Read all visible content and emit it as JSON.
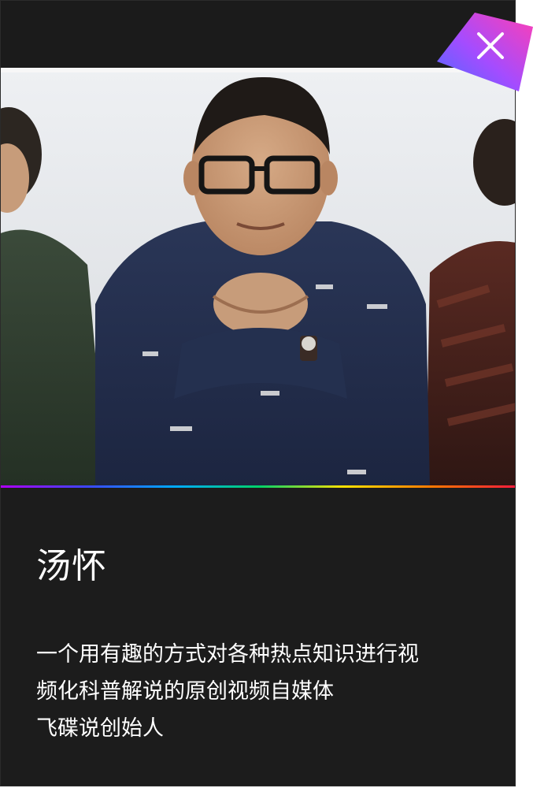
{
  "profile": {
    "name": "汤怀",
    "bio_lines": [
      "一个用有趣的方式对各种热点知识进行视",
      "频化科普解说的原创视频自媒体",
      "飞碟说创始人"
    ]
  },
  "photo": {
    "alt": "Portrait photo"
  },
  "icons": {
    "close": "close-icon"
  },
  "colors": {
    "background": "#1c1c1c",
    "text": "#ffffff",
    "close_gradient_start": "#ff3fb4",
    "close_gradient_end": "#4a6bff"
  }
}
